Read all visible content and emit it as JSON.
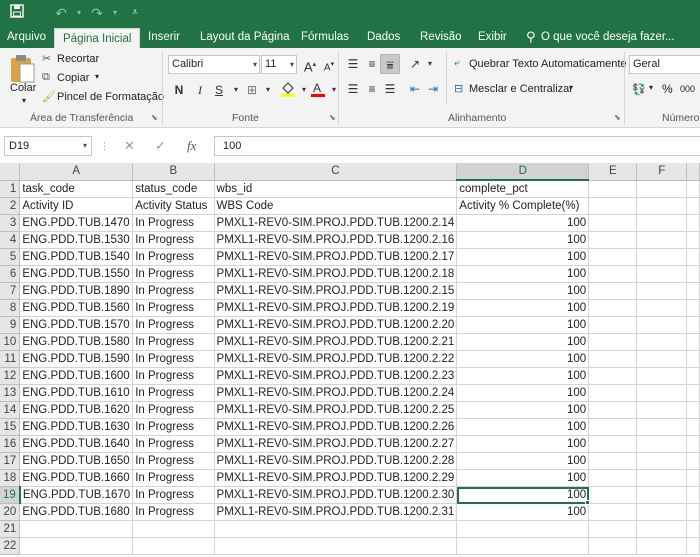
{
  "titlebar": {
    "save_icon": "save-icon",
    "undo_icon": "undo-icon",
    "redo_icon": "redo-icon",
    "qat_icon": "customize-qat-icon"
  },
  "tabs": [
    {
      "label": "Arquivo"
    },
    {
      "label": "Página Inicial"
    },
    {
      "label": "Inserir"
    },
    {
      "label": "Layout da Página"
    },
    {
      "label": "Fórmulas"
    },
    {
      "label": "Dados"
    },
    {
      "label": "Revisão"
    },
    {
      "label": "Exibir"
    }
  ],
  "tell_me": "O que você deseja fazer...",
  "clipboard": {
    "paste": "Colar",
    "cut": "Recortar",
    "copy": "Copiar",
    "format_painter": "Pincel de Formatação",
    "group": "Área de Transferência"
  },
  "font": {
    "name": "Calibri",
    "size": "11",
    "grow": "A",
    "shrink": "A",
    "bold": "N",
    "italic": "I",
    "underline": "S",
    "group": "Fonte",
    "fill_color": "#ffff00",
    "text_color": "#ff0000"
  },
  "alignment": {
    "wrap": "Quebrar Texto Automaticamente",
    "merge": "Mesclar e Centralizar",
    "group": "Alinhamento"
  },
  "number": {
    "format": "Geral",
    "percent": "%",
    "thousands": "000",
    "group": "Número"
  },
  "formula_bar": {
    "cell_ref": "D19",
    "cancel": "✕",
    "enter": "✓",
    "fx": "fx",
    "value": "100"
  },
  "grid": {
    "columns": [
      "A",
      "B",
      "C",
      "D",
      "E",
      "F"
    ],
    "selected_col": "D",
    "selected_row": 19,
    "rows": [
      {
        "n": "1",
        "a": "task_code",
        "b": "status_code",
        "c": "wbs_id",
        "d": "complete_pct"
      },
      {
        "n": "2",
        "a": "Activity ID",
        "b": "Activity Status",
        "c": "WBS Code",
        "d": "Activity % Complete(%)"
      },
      {
        "n": "3",
        "a": "ENG.PDD.TUB.1470",
        "b": "In Progress",
        "c": "PMXL1-REV0-SIM.PROJ.PDD.TUB.1200.2.14",
        "d": "100"
      },
      {
        "n": "4",
        "a": "ENG.PDD.TUB.1530",
        "b": "In Progress",
        "c": "PMXL1-REV0-SIM.PROJ.PDD.TUB.1200.2.16",
        "d": "100"
      },
      {
        "n": "5",
        "a": "ENG.PDD.TUB.1540",
        "b": "In Progress",
        "c": "PMXL1-REV0-SIM.PROJ.PDD.TUB.1200.2.17",
        "d": "100"
      },
      {
        "n": "6",
        "a": "ENG.PDD.TUB.1550",
        "b": "In Progress",
        "c": "PMXL1-REV0-SIM.PROJ.PDD.TUB.1200.2.18",
        "d": "100"
      },
      {
        "n": "7",
        "a": "ENG.PDD.TUB.1890",
        "b": "In Progress",
        "c": "PMXL1-REV0-SIM.PROJ.PDD.TUB.1200.2.15",
        "d": "100"
      },
      {
        "n": "8",
        "a": "ENG.PDD.TUB.1560",
        "b": "In Progress",
        "c": "PMXL1-REV0-SIM.PROJ.PDD.TUB.1200.2.19",
        "d": "100"
      },
      {
        "n": "9",
        "a": "ENG.PDD.TUB.1570",
        "b": "In Progress",
        "c": "PMXL1-REV0-SIM.PROJ.PDD.TUB.1200.2.20",
        "d": "100"
      },
      {
        "n": "10",
        "a": "ENG.PDD.TUB.1580",
        "b": "In Progress",
        "c": "PMXL1-REV0-SIM.PROJ.PDD.TUB.1200.2.21",
        "d": "100"
      },
      {
        "n": "11",
        "a": "ENG.PDD.TUB.1590",
        "b": "In Progress",
        "c": "PMXL1-REV0-SIM.PROJ.PDD.TUB.1200.2.22",
        "d": "100"
      },
      {
        "n": "12",
        "a": "ENG.PDD.TUB.1600",
        "b": "In Progress",
        "c": "PMXL1-REV0-SIM.PROJ.PDD.TUB.1200.2.23",
        "d": "100"
      },
      {
        "n": "13",
        "a": "ENG.PDD.TUB.1610",
        "b": "In Progress",
        "c": "PMXL1-REV0-SIM.PROJ.PDD.TUB.1200.2.24",
        "d": "100"
      },
      {
        "n": "14",
        "a": "ENG.PDD.TUB.1620",
        "b": "In Progress",
        "c": "PMXL1-REV0-SIM.PROJ.PDD.TUB.1200.2.25",
        "d": "100"
      },
      {
        "n": "15",
        "a": "ENG.PDD.TUB.1630",
        "b": "In Progress",
        "c": "PMXL1-REV0-SIM.PROJ.PDD.TUB.1200.2.26",
        "d": "100"
      },
      {
        "n": "16",
        "a": "ENG.PDD.TUB.1640",
        "b": "In Progress",
        "c": "PMXL1-REV0-SIM.PROJ.PDD.TUB.1200.2.27",
        "d": "100"
      },
      {
        "n": "17",
        "a": "ENG.PDD.TUB.1650",
        "b": "In Progress",
        "c": "PMXL1-REV0-SIM.PROJ.PDD.TUB.1200.2.28",
        "d": "100"
      },
      {
        "n": "18",
        "a": "ENG.PDD.TUB.1660",
        "b": "In Progress",
        "c": "PMXL1-REV0-SIM.PROJ.PDD.TUB.1200.2.29",
        "d": "100"
      },
      {
        "n": "19",
        "a": "ENG.PDD.TUB.1670",
        "b": "In Progress",
        "c": "PMXL1-REV0-SIM.PROJ.PDD.TUB.1200.2.30",
        "d": "100"
      },
      {
        "n": "20",
        "a": "ENG.PDD.TUB.1680",
        "b": "In Progress",
        "c": "PMXL1-REV0-SIM.PROJ.PDD.TUB.1200.2.31",
        "d": "100"
      },
      {
        "n": "21",
        "a": "",
        "b": "",
        "c": "",
        "d": ""
      },
      {
        "n": "22",
        "a": "",
        "b": "",
        "c": "",
        "d": ""
      }
    ]
  }
}
